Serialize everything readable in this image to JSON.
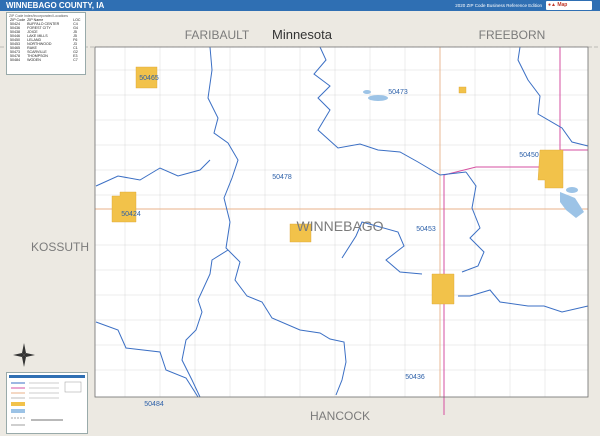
{
  "title": "WINNEBAGO COUNTY, IA",
  "edition": "2020 ZIP Code Business Reference Edition",
  "county_label": "WINNEBAGO",
  "neighbors": {
    "faribault": "FARIBAULT",
    "minnesota": "Minnesota",
    "freeborn": "FREEBORN",
    "kossuth": "KOSSUTH",
    "hancock": "HANCOCK"
  },
  "zip_labels": [
    "50465",
    "50473",
    "50450",
    "50478",
    "50424",
    "50453",
    "50436",
    "50484"
  ],
  "legend": {
    "header": "ZIP Code Index/Incorporated Locations",
    "columns": [
      "ZIP Code",
      "ZIP Name",
      "LOC"
    ],
    "rows": [
      [
        "50424",
        "BUFFALO CENTER",
        "C4"
      ],
      [
        "50436",
        "FOREST CITY",
        "G4"
      ],
      [
        "50438",
        "JOICE",
        "J5"
      ],
      [
        "50446",
        "LAKE MILLS",
        "J5"
      ],
      [
        "50450",
        "LELAND",
        "F6"
      ],
      [
        "50453",
        "NORTHWOOD",
        "J3"
      ],
      [
        "50465",
        "RAKE",
        "C1"
      ],
      [
        "50473",
        "SCARVILLE",
        "G2"
      ],
      [
        "50478",
        "THOMPSON",
        "E3"
      ],
      [
        "50484",
        "WODEN",
        "C7"
      ]
    ]
  },
  "colors": {
    "title_bar": "#2f6fb3",
    "outside": "#ece9e2",
    "zip_boundary": "#3b6fc4",
    "town_fill": "#f2c24a",
    "water": "#9cc3e6",
    "highway": "#d64fa0",
    "road": "#e8b28a"
  }
}
